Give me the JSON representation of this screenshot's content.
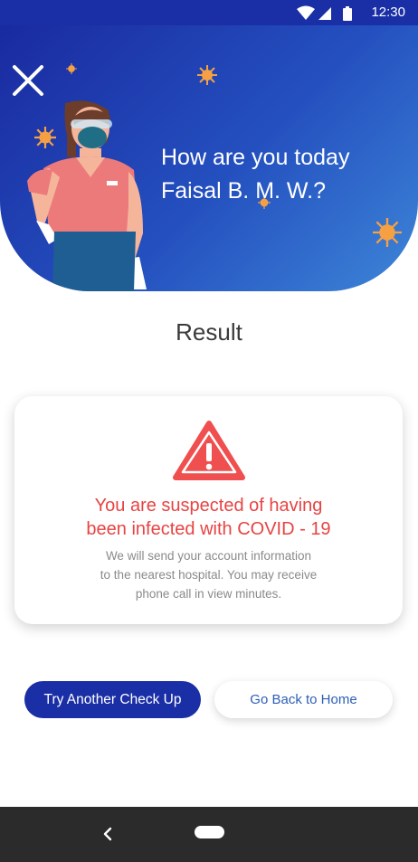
{
  "status_bar": {
    "time": "12:30"
  },
  "header": {
    "greeting_line1": "How are you today",
    "greeting_line2": "Faisal B. M. W.?"
  },
  "result": {
    "title": "Result",
    "warning_line1": "You are suspected of having",
    "warning_line2": "been infected with COVID - 19",
    "info_line1": "We will send your account information",
    "info_line2": "to the nearest hospital. You may receive",
    "info_line3": "phone call in view minutes."
  },
  "buttons": {
    "try_again": "Try Another Check Up",
    "home": "Go Back to Home"
  },
  "colors": {
    "primary": "#1a2fa6",
    "warning": "#e84343",
    "link": "#2d5fb6"
  },
  "icons": [
    "wifi-icon",
    "signal-icon",
    "battery-icon",
    "close-icon",
    "warning-icon",
    "back-icon",
    "home-icon",
    "virus-icon"
  ]
}
